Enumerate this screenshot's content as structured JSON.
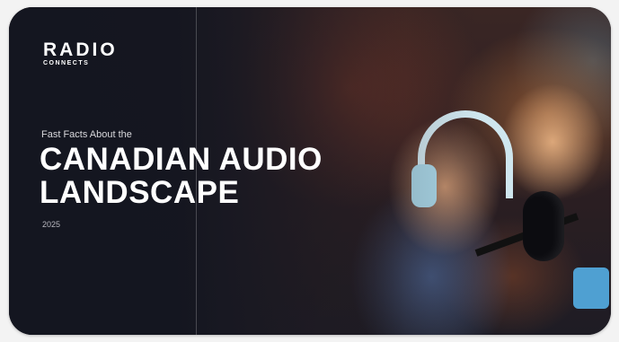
{
  "brand": {
    "logo_top": "RADIO",
    "logo_bottom": "CONNECTS"
  },
  "hero": {
    "kicker": "Fast Facts About the",
    "headline_line1": "CANADIAN AUDIO",
    "headline_line2": "LANDSCAPE",
    "year": "2025"
  },
  "icons": {
    "photo": "podcast-hosts-photo"
  },
  "colors": {
    "panel": "#1a1c26",
    "text": "#ffffff",
    "muted": "#d8d8dc"
  }
}
